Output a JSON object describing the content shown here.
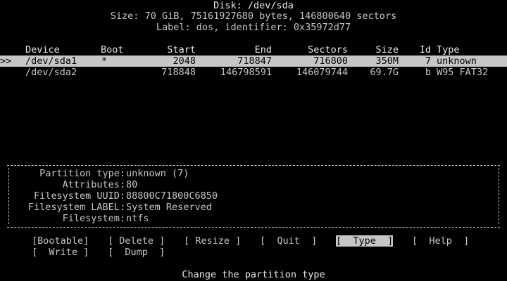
{
  "header": {
    "title": "Disk: /dev/sda",
    "size_line": "Size: 70 GiB, 75161927680 bytes, 146800640 sectors",
    "label_line": "Label: dos, identifier: 0x35972d77"
  },
  "table": {
    "columns": [
      "Device",
      "Boot",
      "Start",
      "End",
      "Sectors",
      "Size",
      "Id",
      "Type"
    ],
    "selection_marker": ">>",
    "rows": [
      {
        "device": "/dev/sda1",
        "boot": "*",
        "start": "2048",
        "end": "718847",
        "sectors": "716800",
        "size": "350M",
        "id": "7",
        "type": "unknown",
        "selected": true
      },
      {
        "device": "/dev/sda2",
        "boot": "",
        "start": "718848",
        "end": "146798591",
        "sectors": "146079744",
        "size": "69.7G",
        "id": "b",
        "type": "W95 FAT32",
        "selected": false
      }
    ]
  },
  "details": {
    "lines": [
      {
        "key": "Partition type:",
        "value": "unknown (7)"
      },
      {
        "key": "Attributes:",
        "value": "80"
      },
      {
        "key": "Filesystem UUID:",
        "value": "88800C71800C6850"
      },
      {
        "key": "Filesystem LABEL:",
        "value": "System Reserved"
      },
      {
        "key": "Filesystem:",
        "value": "ntfs"
      }
    ]
  },
  "menu": {
    "items": [
      {
        "label": "[Bootable]",
        "active": false
      },
      {
        "label": "[ Delete ]",
        "active": false
      },
      {
        "label": "[ Resize ]",
        "active": false
      },
      {
        "label": "[  Quit  ]",
        "active": false
      },
      {
        "label": "[  Type  ]",
        "active": true
      },
      {
        "label": "[  Help  ]",
        "active": false
      },
      {
        "label": "[  Write ]",
        "active": false
      },
      {
        "label": "[  Dump  ]",
        "active": false
      }
    ]
  },
  "status": {
    "hint": "Change the partition type"
  },
  "colors": {
    "background": "#000000",
    "text": "#c6c6c6",
    "highlight_bg": "#c6c6c6",
    "highlight_text": "#000000"
  }
}
